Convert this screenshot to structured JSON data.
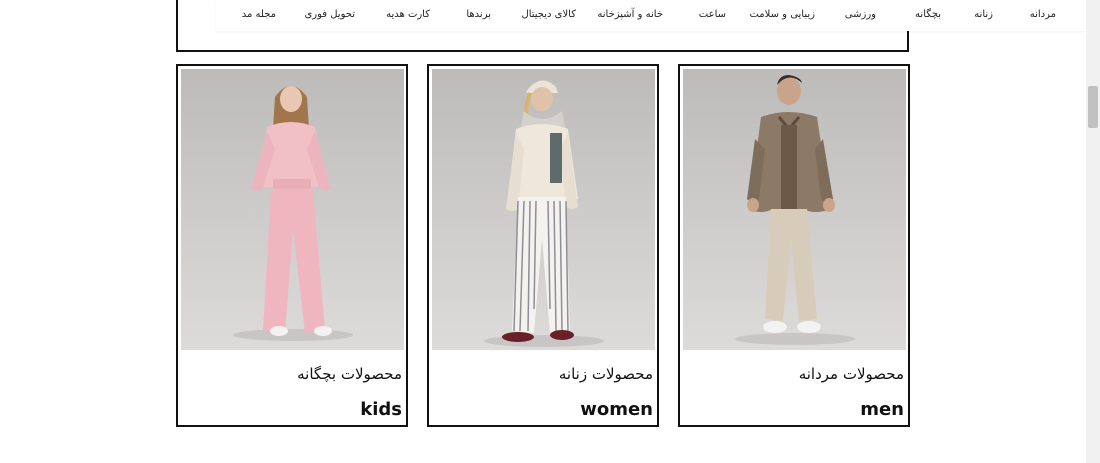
{
  "nav": {
    "items": [
      {
        "label": "مردانه"
      },
      {
        "label": "زنانه"
      },
      {
        "label": "بچگانه"
      },
      {
        "label": "ورزشی"
      },
      {
        "label": "زیبایی و سلامت"
      },
      {
        "label": "ساعت"
      },
      {
        "label": "خانه و آشپزخانه"
      },
      {
        "label": "کالای دیجیتال"
      },
      {
        "label": "برندها"
      },
      {
        "label": "کارت هدیه"
      },
      {
        "label": "تحویل فوری"
      },
      {
        "label": "مجله مد"
      }
    ]
  },
  "cards": [
    {
      "title_fa": "محصولات مردانه",
      "title_en": "men"
    },
    {
      "title_fa": "محصولات زنانه",
      "title_en": "women"
    },
    {
      "title_fa": "محصولات بچگانه",
      "title_en": "kids"
    }
  ],
  "colors": {
    "border": "#111111",
    "photo_bg": "#cfcdcc",
    "scrollbar_track": "#f1f1f1",
    "scrollbar_thumb": "#c1c1c1"
  }
}
